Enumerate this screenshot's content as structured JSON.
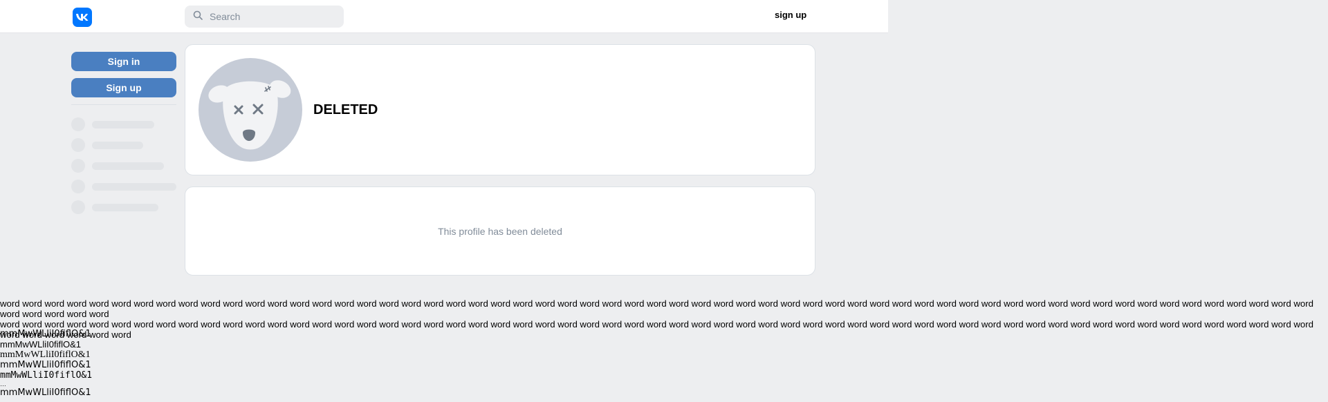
{
  "header": {
    "logo_icon": "vk-logo-icon",
    "search_placeholder": "Search",
    "signup_label": "sign up"
  },
  "sidebar": {
    "signin_label": "Sign in",
    "signup_label": "Sign up"
  },
  "profile": {
    "name": "DELETED",
    "avatar_icon": "deleted-dog-avatar-icon",
    "deleted_message": "This profile has been deleted"
  },
  "test_text": {
    "word_lines": [
      "word word word word word word word word word word word word word word word word word word word word word word word word word word word word word word word word word word word word word word word word word word word word word word word word word word word word word word word word word word word word word word word word",
      "word word word word word word word word word word word word word word word word word word word word word word word word word word word word word word word word word word word word word word word word word word word word word word word word word word word word word word word word word word word word word word word word word"
    ],
    "glyph_lines": [
      "mmMwWLliI0fiflO&1",
      "mmMwWLliI0fiflO&1",
      "mmMwWLliI0fiflO&1",
      "mmMwWLliI0fiflO&1",
      "mmMwWLliI0fiflO&1",
      "…",
      "mmMwWLliI0fiflO&1"
    ]
  },
  "colors": {
    "accent": "#0077ff",
    "button": "#4a7fc1",
    "background": "#edeef0"
  }
}
